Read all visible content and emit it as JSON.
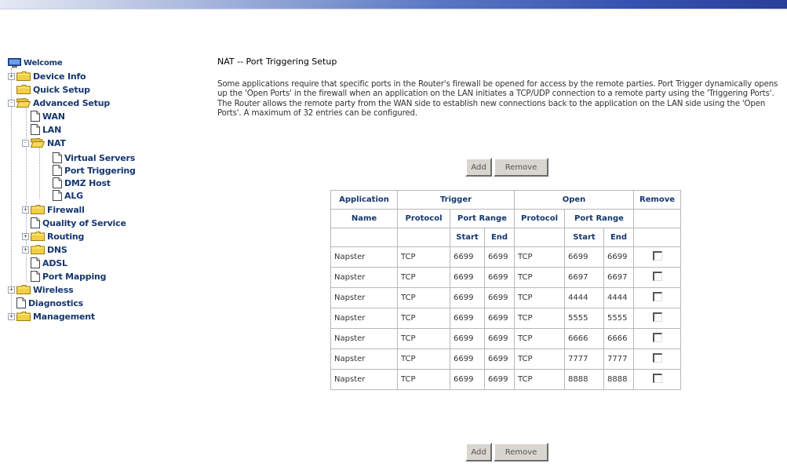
{
  "tree": {
    "welcome": "Welcome",
    "device_info": "Device Info",
    "quick_setup": "Quick Setup",
    "advanced_setup": "Advanced Setup",
    "wan": "WAN",
    "lan": "LAN",
    "nat": "NAT",
    "virtual_servers": "Virtual Servers",
    "port_triggering": "Port Triggering",
    "dmz_host": "DMZ Host",
    "alg": "ALG",
    "firewall": "Firewall",
    "quality_of_service": "Quality of Service",
    "routing": "Routing",
    "dns": "DNS",
    "adsl": "ADSL",
    "port_mapping": "Port Mapping",
    "wireless": "Wireless",
    "diagnostics": "Diagnostics",
    "management": "Management"
  },
  "page": {
    "title": "NAT -- Port Triggering Setup",
    "description": "Some applications require that specific ports in the Router's firewall be opened for access by the remote parties. Port Trigger dynamically opens up the 'Open Ports' in the firewall when an application on the LAN initiates a TCP/UDP connection to a remote party using the 'Triggering Ports'. The Router allows the remote party from the WAN side to establish new connections back to the application on the LAN side using the 'Open Ports'. A maximum of 32 entries can be configured."
  },
  "buttons": {
    "add": "Add",
    "remove": "Remove"
  },
  "table": {
    "h_application": "Application",
    "h_trigger": "Trigger",
    "h_open": "Open",
    "h_remove": "Remove",
    "h_name": "Name",
    "h_protocol": "Protocol",
    "h_port_range": "Port Range",
    "h_start": "Start",
    "h_end": "End",
    "rows": [
      {
        "name": "Napster",
        "tproto": "TCP",
        "tstart": "6699",
        "tend": "6699",
        "oproto": "TCP",
        "ostart": "6699",
        "oend": "6699"
      },
      {
        "name": "Napster",
        "tproto": "TCP",
        "tstart": "6699",
        "tend": "6699",
        "oproto": "TCP",
        "ostart": "6697",
        "oend": "6697"
      },
      {
        "name": "Napster",
        "tproto": "TCP",
        "tstart": "6699",
        "tend": "6699",
        "oproto": "TCP",
        "ostart": "4444",
        "oend": "4444"
      },
      {
        "name": "Napster",
        "tproto": "TCP",
        "tstart": "6699",
        "tend": "6699",
        "oproto": "TCP",
        "ostart": "5555",
        "oend": "5555"
      },
      {
        "name": "Napster",
        "tproto": "TCP",
        "tstart": "6699",
        "tend": "6699",
        "oproto": "TCP",
        "ostart": "6666",
        "oend": "6666"
      },
      {
        "name": "Napster",
        "tproto": "TCP",
        "tstart": "6699",
        "tend": "6699",
        "oproto": "TCP",
        "ostart": "7777",
        "oend": "7777"
      },
      {
        "name": "Napster",
        "tproto": "TCP",
        "tstart": "6699",
        "tend": "6699",
        "oproto": "TCP",
        "ostart": "8888",
        "oend": "8888"
      }
    ]
  },
  "colors": {
    "tree_text": "#16376e",
    "folder_yellow": "#f2cf43",
    "header_bar": "#3652b0"
  }
}
